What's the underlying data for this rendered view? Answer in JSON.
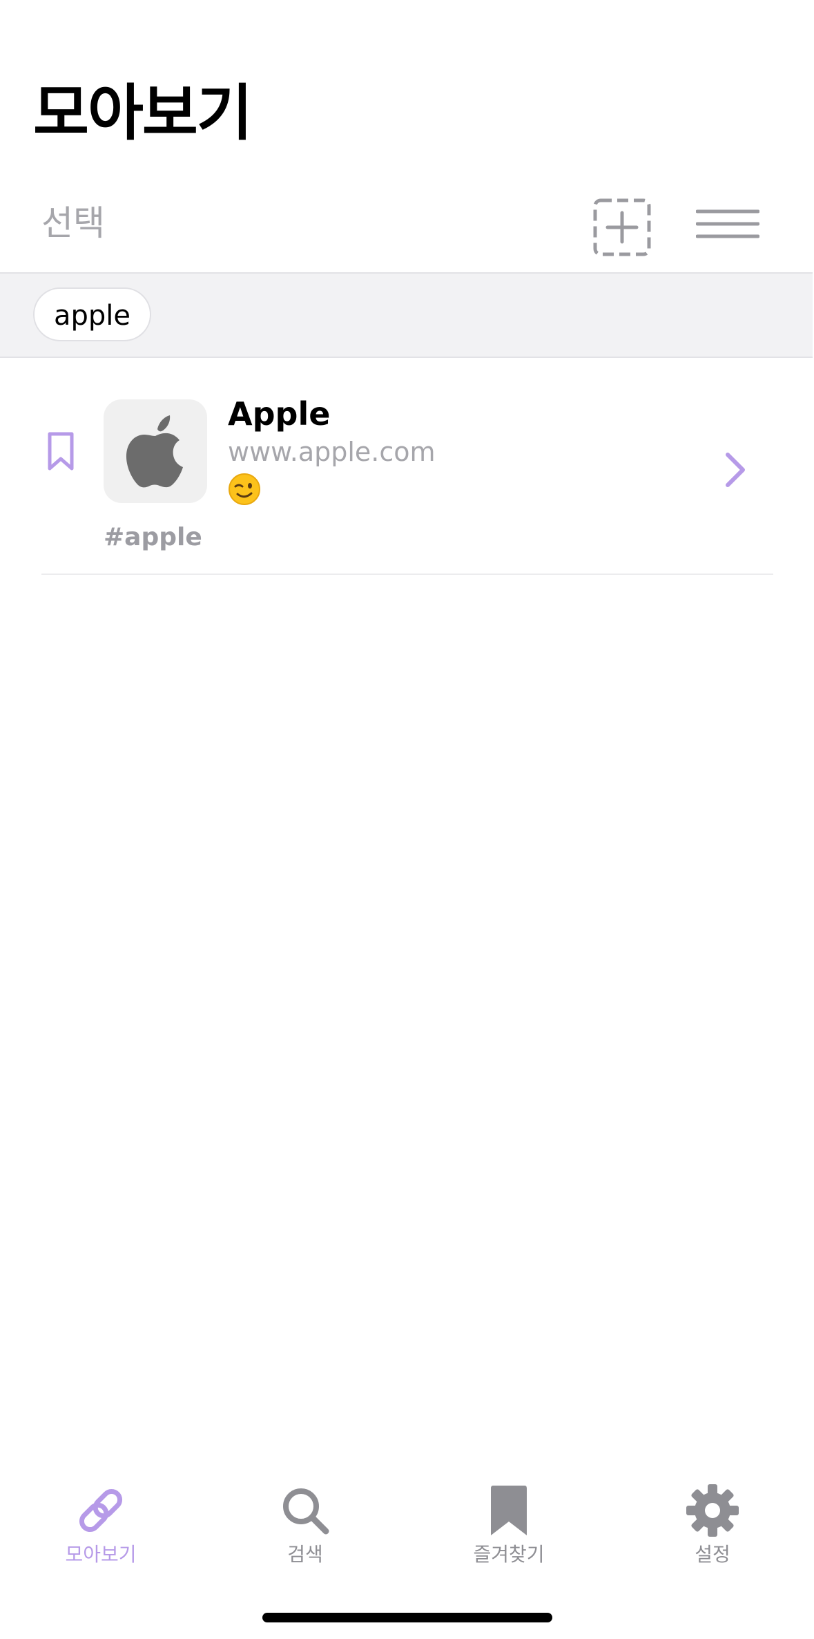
{
  "header": {
    "title": "모아보기",
    "select_label": "선택",
    "add_icon": "dashed-plus-square-icon",
    "menu_icon": "hamburger-menu-icon"
  },
  "tag_filter": {
    "tags": [
      "apple"
    ]
  },
  "bookmarks": [
    {
      "title": "Apple",
      "url": "www.apple.com",
      "memo": "😉",
      "tags": "#apple",
      "favicon": "apple-logo-icon",
      "bookmarked_icon": "bookmark-outline-icon"
    }
  ],
  "tabs": [
    {
      "label": "모아보기",
      "icon": "link-icon",
      "active": true
    },
    {
      "label": "검색",
      "icon": "search-icon",
      "active": false
    },
    {
      "label": "즐겨찾기",
      "icon": "bookmark-icon",
      "active": false
    },
    {
      "label": "설정",
      "icon": "gear-icon",
      "active": false
    }
  ],
  "colors": {
    "accent": "#b69ae8",
    "secondary_text": "#a6a6ab",
    "inactive_tab": "#8e8e93"
  }
}
